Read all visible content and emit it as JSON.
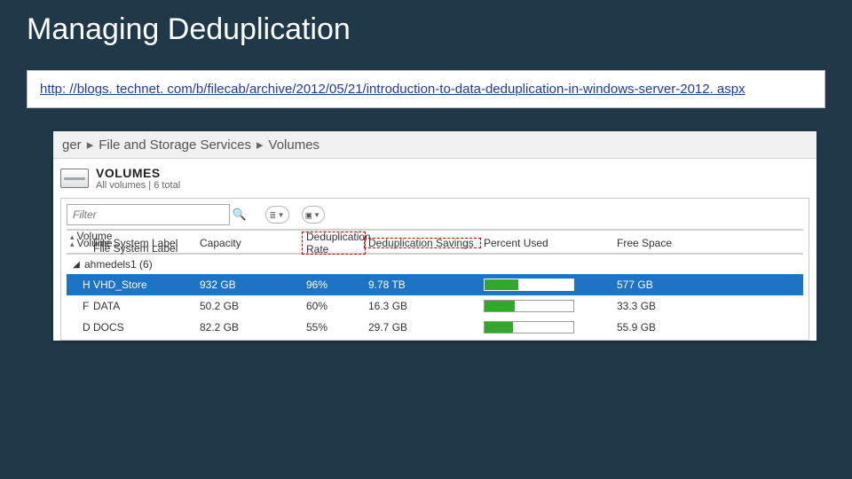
{
  "slide": {
    "title": "Managing Deduplication"
  },
  "url": {
    "href": "http://blogs.technet.com/b/filecab/archive/2012/05/21/introduction-to-data-deduplication-in-windows-server-2012.aspx",
    "text": "http: //blogs. technet. com/b/filecab/archive/2012/05/21/introduction-to-data-deduplication-in-windows-server-2012. aspx"
  },
  "breadcrumb": {
    "seg1": "ger",
    "seg2": "File and Storage Services",
    "seg3": "Volumes"
  },
  "section": {
    "title": "VOLUMES",
    "subtitle": "All volumes | 6 total"
  },
  "toolbar": {
    "filter_placeholder": "Filter"
  },
  "columns": {
    "volume": "Volume",
    "label": "File System Label",
    "capacity": "Capacity",
    "dedup_rate": "Deduplication Rate",
    "dedup_savings": "Deduplication Savings",
    "percent_used": "Percent Used",
    "free": "Free Space"
  },
  "group": {
    "name": "ahmedels1 (6)"
  },
  "rows": [
    {
      "selected": true,
      "volume": "H:",
      "label": "VHD_Store",
      "capacity": "932 GB",
      "rate": "96%",
      "savings": "9.78 TB",
      "used_pct": 38,
      "free": "577 GB"
    },
    {
      "selected": false,
      "volume": "F:",
      "label": "DATA",
      "capacity": "50.2 GB",
      "rate": "60%",
      "savings": "16.3 GB",
      "used_pct": 34,
      "free": "33.3 GB"
    },
    {
      "selected": false,
      "volume": "D:",
      "label": "DOCS",
      "capacity": "82.2 GB",
      "rate": "55%",
      "savings": "29.7 GB",
      "used_pct": 32,
      "free": "55.9 GB"
    }
  ]
}
